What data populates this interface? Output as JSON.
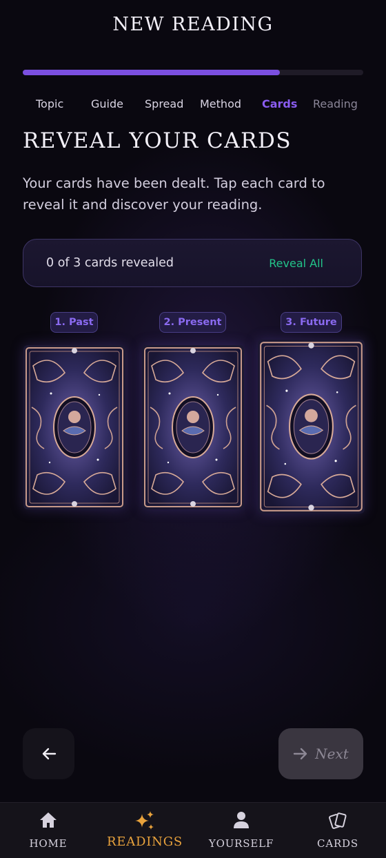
{
  "header": {
    "title": "NEW READING"
  },
  "progress": {
    "fraction": 0.755
  },
  "steps": [
    {
      "label": "Topic",
      "state": "done"
    },
    {
      "label": "Guide",
      "state": "done"
    },
    {
      "label": "Spread",
      "state": "done"
    },
    {
      "label": "Method",
      "state": "done"
    },
    {
      "label": "Cards",
      "state": "active"
    },
    {
      "label": "Reading",
      "state": "upcoming"
    }
  ],
  "section": {
    "heading": "REVEAL YOUR CARDS",
    "description": "Your cards have been dealt. Tap each card to reveal it and discover your reading."
  },
  "status": {
    "text": "0 of 3 cards revealed",
    "reveal_all_label": "Reveal All"
  },
  "cards": [
    {
      "label": "1. Past",
      "revealed": false
    },
    {
      "label": "2. Present",
      "revealed": false
    },
    {
      "label": "3. Future",
      "revealed": false
    }
  ],
  "footer": {
    "back_icon": "arrow-left-icon",
    "next_label": "Next",
    "next_icon": "arrow-right-icon"
  },
  "nav": [
    {
      "label": "HOME",
      "icon": "home-icon"
    },
    {
      "label": "READINGS",
      "icon": "sparkles-icon",
      "active": true
    },
    {
      "label": "YOURSELF",
      "icon": "person-icon"
    },
    {
      "label": "CARDS",
      "icon": "cards-icon"
    }
  ],
  "colors": {
    "accent": "#7b4fe0",
    "active_step": "#8a5cf0",
    "reveal_all": "#22c58a",
    "nav_active": "#e8a23c",
    "background": "#0a0810"
  }
}
